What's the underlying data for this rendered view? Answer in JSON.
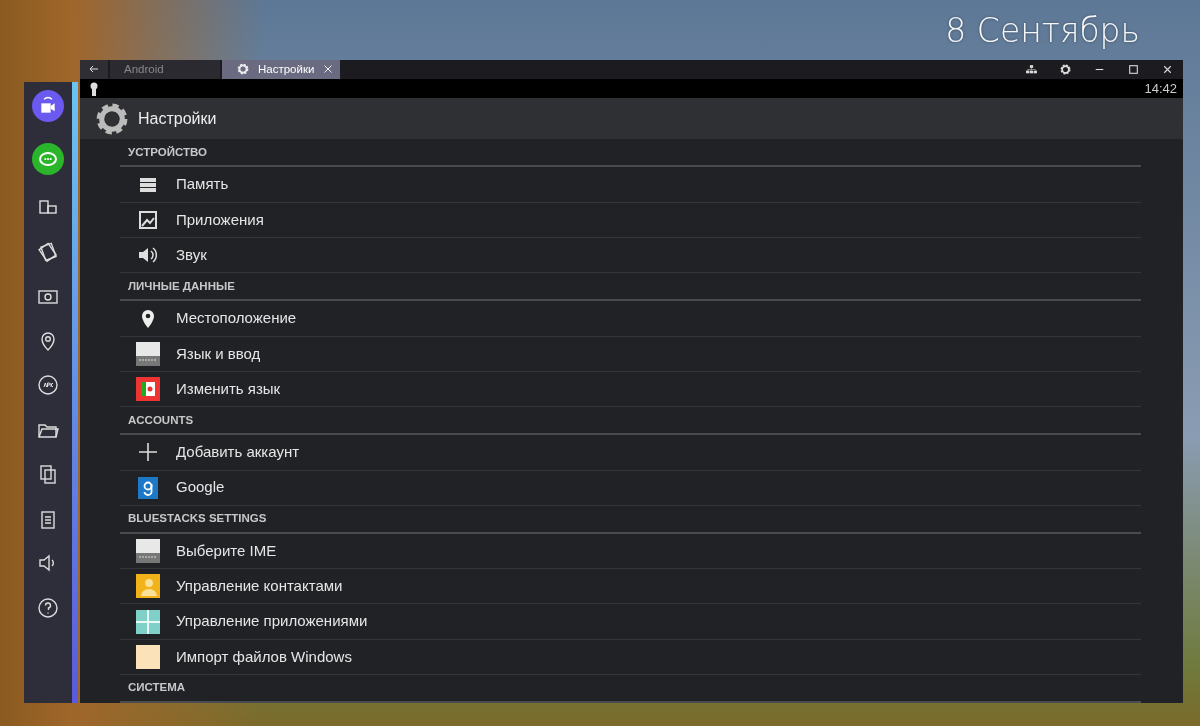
{
  "desktop": {
    "date": "8 Сентябрь"
  },
  "tabs": [
    {
      "label": "Android",
      "selected": false
    },
    {
      "label": "Настройки",
      "selected": true
    }
  ],
  "status_bar": {
    "time": "14:42"
  },
  "action_bar": {
    "title": "Настройки"
  },
  "sections": [
    {
      "header": "УСТРОЙСТВО",
      "items": [
        "Память",
        "Приложения",
        "Звук"
      ]
    },
    {
      "header": "ЛИЧНЫЕ ДАННЫЕ",
      "items": [
        "Местоположение",
        "Язык и ввод",
        "Изменить язык"
      ]
    },
    {
      "header": "ACCOUNTS",
      "items": [
        "Добавить аккаунт",
        "Google"
      ]
    },
    {
      "header": "BLUESTACKS SETTINGS",
      "items": [
        "Выберите IME",
        "Управление контактами",
        "Управление приложениями",
        "Импорт файлов Windows"
      ]
    },
    {
      "header": "СИСТЕМА"
    }
  ]
}
